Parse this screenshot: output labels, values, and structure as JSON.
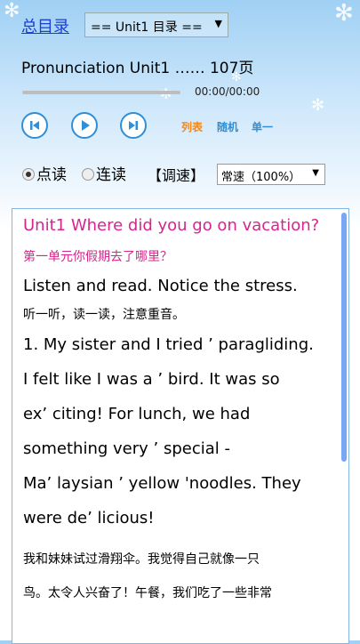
{
  "header": {
    "menu_link": "总目录",
    "unit_select_value": "== Unit1 目录 ==",
    "track_title": "Pronunciation Unit1 …… 107页"
  },
  "player": {
    "time": "00:00/00:00",
    "progress": 0.0,
    "modes": [
      "列表",
      "随机",
      "单一"
    ]
  },
  "reading": {
    "point_read": "点读",
    "continuous_read": "连读",
    "adjust_label": "【调速】",
    "speed_value": "常速（100%）"
  },
  "content": {
    "title": "Unit1 Where did you go on vacation?",
    "title_zh": "第一单元你假期去了哪里？",
    "instruction": "Listen and read. Notice the stress.",
    "instruction_zh": "听一听，读一读，注意重音。",
    "para_lines": [
      "1. My sister and I tried ’ paragliding.",
      "I felt like I was a ’ bird. It was so",
      "ex’ citing! For lunch, we had",
      "something very ’ special -",
      "Ma’ laysian ’ yellow 'noodles. They",
      "were de’ licious!"
    ],
    "para_zh_lines": [
      "我和妹妹试过滑翔伞。我觉得自己就像一只",
      "鸟。太令人兴奋了！午餐，我们吃了一些非常"
    ]
  },
  "colors": {
    "accent_pink": "#d6258d",
    "player_blue": "#2f8fd8",
    "mode_orange": "#f0891e",
    "mode_blue": "#2f8fd8"
  }
}
